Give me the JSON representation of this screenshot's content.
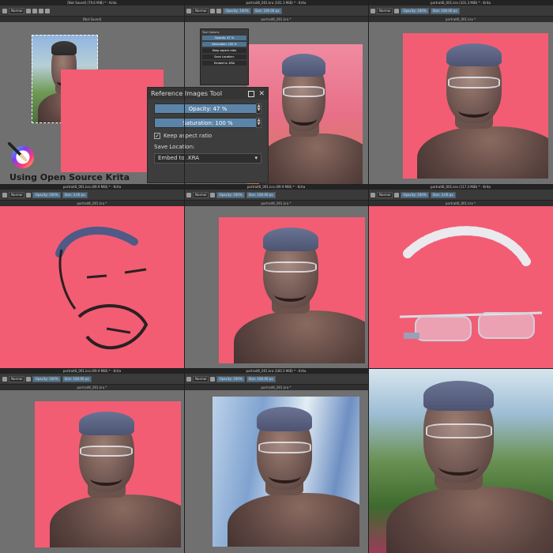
{
  "cells": [
    {
      "id": "cell-1",
      "title": "[Not Saved] (79.6 MiB) * - Krita",
      "toolbar": {
        "blend": "Normal",
        "opacity": "Opacity: 100%",
        "size": "Size: 100.00 px"
      },
      "tab": "[Not Saved]",
      "docker": {
        "title": "Tool Options",
        "row1": "Opacity: 47 %",
        "row2": "Saturation: 100 %",
        "row3": "Keep aspect ratio",
        "row4": "Save Location:",
        "row5": "Embed to .KRA"
      }
    },
    {
      "id": "cell-2",
      "title": "portrait6_001.kra (101.3 MiB) * - Krita",
      "toolbar": {
        "blend": "Normal",
        "opacity": "Opacity: 100%",
        "size": "Size: 100.00 px"
      },
      "tab": "portrait6_001.kra *"
    },
    {
      "id": "cell-3",
      "title": "portrait6_001.kra (101.3 MiB) * - Krita",
      "toolbar": {
        "blend": "Normal",
        "opacity": "Opacity: 100%",
        "size": "Size: 100.00 px"
      },
      "tab": "portrait6_001.kra *"
    },
    {
      "id": "cell-4",
      "title": "portrait6_001.kra (69.9 MiB) * - Krita",
      "toolbar": {
        "blend": "Normal",
        "opacity": "Opacity: 100%",
        "size": "Size: 3.00 px"
      },
      "tab": "portrait6_001.kra *"
    },
    {
      "id": "cell-5",
      "title": "portrait6_001.kra (69.9 MiB) * - Krita",
      "toolbar": {
        "blend": "Normal",
        "opacity": "Opacity: 100%",
        "size": "Size: 100.00 px"
      },
      "tab": "portrait6_001.kra *"
    },
    {
      "id": "cell-6",
      "title": "portrait6_001.kra (117.3 MiB) * - Krita",
      "toolbar": {
        "blend": "Normal",
        "opacity": "Opacity: 100%",
        "size": "Size: 3.00 px"
      },
      "tab": "portrait6_001.kra *"
    },
    {
      "id": "cell-7",
      "title": "portrait6_001.kra (69.9 MiB) * - Krita",
      "toolbar": {
        "blend": "Normal",
        "opacity": "Opacity: 100%",
        "size": "Size: 100.00 px"
      },
      "tab": "portrait6_001.kra *"
    },
    {
      "id": "cell-8",
      "title": "portrait6_001.kra (160.5 MiB) * - Krita",
      "toolbar": {
        "blend": "Normal",
        "opacity": "Opacity: 100%",
        "size": "Size: 100.00 px"
      },
      "tab": "portrait6_001.kra *"
    }
  ],
  "reference_tool": {
    "title": "Reference Images Tool",
    "opacity": "Opacity: 47 %",
    "saturation": "Saturation: 100 %",
    "keep_aspect": "Keep aspect ratio",
    "save_location_label": "Save Location:",
    "save_location_value": "Embed to .KRA"
  },
  "logo": {
    "text": "Using Open Source Krita"
  },
  "colors": {
    "canvas_pink": "#f25d74",
    "ui_dark": "#3a3a3a",
    "ui_accent": "#4f7594"
  }
}
